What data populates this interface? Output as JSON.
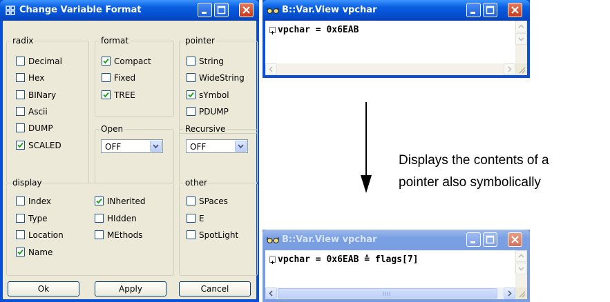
{
  "dialog": {
    "title": "Change Variable Format",
    "radix": {
      "legend": "radix",
      "items": [
        {
          "label": "Decimal",
          "checked": false
        },
        {
          "label": "Hex",
          "checked": false
        },
        {
          "label": "BINary",
          "checked": false
        },
        {
          "label": "Ascii",
          "checked": false
        },
        {
          "label": "DUMP",
          "checked": false
        },
        {
          "label": "SCALED",
          "checked": true
        }
      ]
    },
    "format": {
      "legend": "format",
      "items": [
        {
          "label": "Compact",
          "checked": true
        },
        {
          "label": "Fixed",
          "checked": false
        },
        {
          "label": "TREE",
          "checked": true
        }
      ]
    },
    "pointer": {
      "legend": "pointer",
      "items": [
        {
          "label": "String",
          "checked": false
        },
        {
          "label": "WideString",
          "checked": false
        },
        {
          "label": "sYmbol",
          "checked": true
        },
        {
          "label": "PDUMP",
          "checked": false
        }
      ]
    },
    "open": {
      "legend": "Open",
      "value": "OFF"
    },
    "recursive": {
      "legend": "Recursive",
      "value": "OFF"
    },
    "display": {
      "legend": "display",
      "items": [
        {
          "label": "Index",
          "checked": false
        },
        {
          "label": "Type",
          "checked": false
        },
        {
          "label": "Location",
          "checked": false
        },
        {
          "label": "Name",
          "checked": true
        },
        {
          "label": "INherited",
          "checked": true
        },
        {
          "label": "HIdden",
          "checked": false
        },
        {
          "label": "MEthods",
          "checked": false
        }
      ]
    },
    "other": {
      "legend": "other",
      "items": [
        {
          "label": "SPaces",
          "checked": false
        },
        {
          "label": "E",
          "checked": false
        },
        {
          "label": "SpotLight",
          "checked": false
        }
      ]
    },
    "buttons": {
      "ok": "Ok",
      "apply": "Apply",
      "cancel": "Cancel"
    }
  },
  "view_top": {
    "title": "B::Var.View vpchar",
    "line": "vpchar = 0x6EAB"
  },
  "view_bottom": {
    "title": "B::Var.View vpchar",
    "line": "vpchar = 0x6EAB ≙ flags[7]"
  },
  "annotation": {
    "line1": "Displays the contents of a",
    "line2": "pointer also symbolically"
  }
}
